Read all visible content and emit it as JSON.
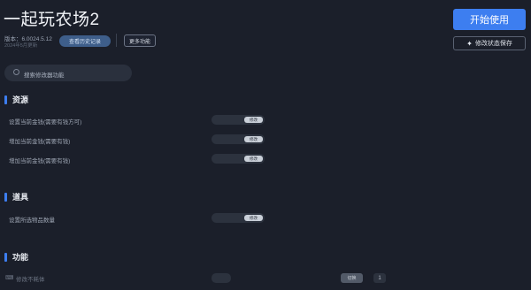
{
  "app": {
    "title": "一起玩农场2"
  },
  "meta": {
    "version": "版本：6.0024.5.12",
    "subtext": "2024年5月更新"
  },
  "header": {
    "history_label": "查看历史记录",
    "more_label": "更多功能"
  },
  "actions": {
    "start_label": "开始使用",
    "save_label": "修改状态保存"
  },
  "search": {
    "placeholder": "搜索修改器功能"
  },
  "sections": {
    "resources": {
      "title": "资源",
      "rows": [
        {
          "label": "设置当前金钱(需要有钱方可)",
          "button": "修改"
        },
        {
          "label": "增加当前金钱(需要有钱)",
          "button": "修改"
        },
        {
          "label": "增加当前金钱(需要有钱)",
          "button": "修改"
        }
      ]
    },
    "items": {
      "title": "道具",
      "rows": [
        {
          "label": "设置所选物品数量",
          "button": "修改"
        }
      ]
    },
    "functions": {
      "title": "功能",
      "rows": [
        {
          "label": "修改不耗体",
          "toggle_label": "切换",
          "value": "1"
        }
      ]
    }
  },
  "colors": {
    "accent": "#3d7ef0",
    "background": "#1b1f2a"
  }
}
